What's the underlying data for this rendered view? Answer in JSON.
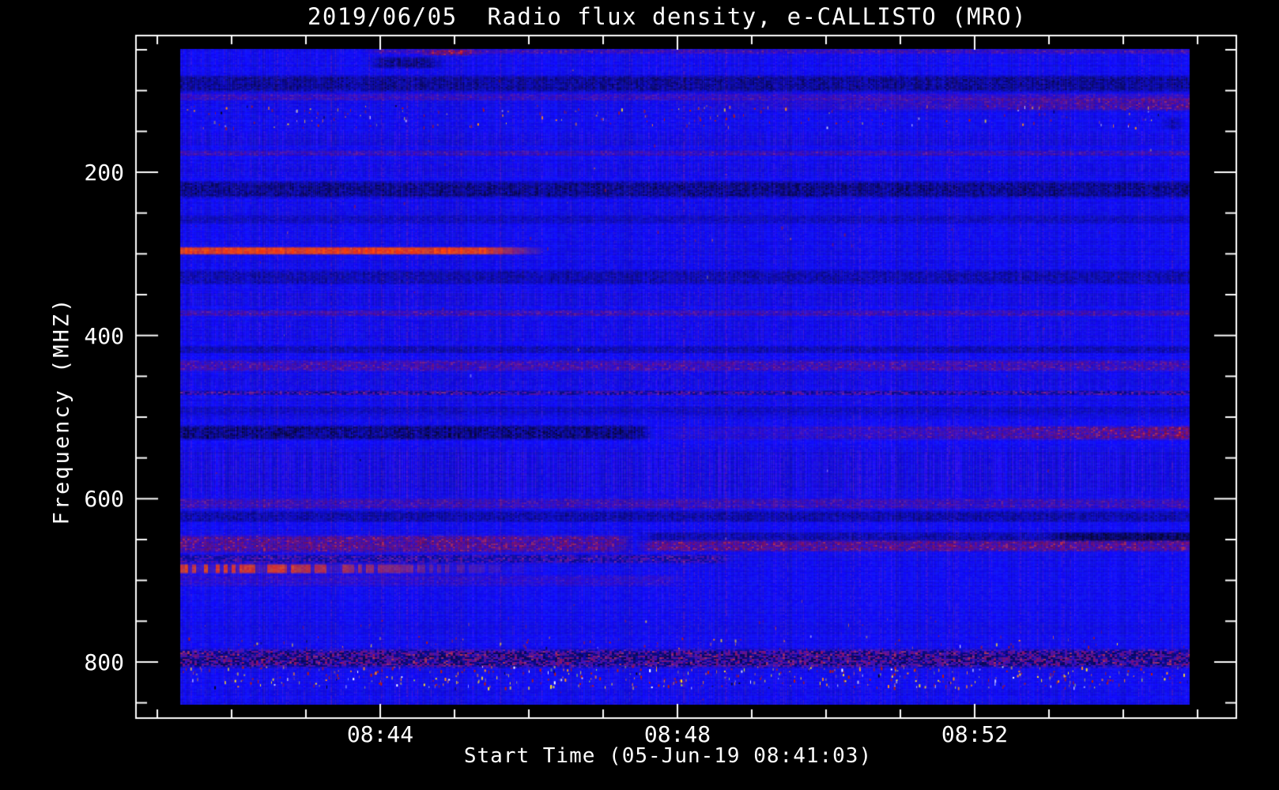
{
  "chart_data": {
    "type": "heatmap",
    "title": "2019/06/05  Radio flux density, e-CALLISTO (MRO)",
    "xlabel": "Start Time (05-Jun-19 08:41:03)",
    "ylabel": "Frequency (MHZ)",
    "instrument": "e-CALLISTO (MRO)",
    "date": "2019/06/05",
    "start_time": "08:41:03",
    "time_span": [
      "08:41:03",
      "08:55:00"
    ],
    "freq_span_mhz": [
      45,
      870
    ],
    "legend": "none",
    "grid": "off",
    "x_axis": {
      "major_ticks": [
        {
          "minute": 44,
          "label": "08:44"
        },
        {
          "minute": 48,
          "label": "08:48"
        },
        {
          "minute": 52,
          "label": "08:52"
        }
      ],
      "minor_tick_minutes": [
        41,
        42,
        43,
        45,
        46,
        47,
        49,
        50,
        51,
        53,
        54,
        55
      ]
    },
    "y_axis": {
      "major_ticks": [
        {
          "mhz": 200,
          "label": "200"
        },
        {
          "mhz": 400,
          "label": "400"
        },
        {
          "mhz": 600,
          "label": "600"
        },
        {
          "mhz": 800,
          "label": "800"
        }
      ],
      "minor_tick_mhz": [
        50,
        100,
        150,
        250,
        300,
        350,
        450,
        500,
        550,
        650,
        700,
        750,
        850
      ]
    },
    "colormap": "blue-red-yellow-white",
    "palette": {
      "background": "#000000",
      "frame": "#ffffff",
      "text": "#ffffff",
      "base_blue": "#1d14e6",
      "purple": "#6a28d8",
      "dark": "#04041a",
      "red": "#c01c08",
      "bright_red": "#f03008",
      "orange": "#ff8c1a",
      "yellow": "#ffe224",
      "white_hot": "#ffffff",
      "green": "#b8f030"
    },
    "features": [
      {
        "n": "top-edge-red-mottle",
        "k": "red",
        "x": [
          0.18,
          1
        ],
        "y": [
          0,
          0.008
        ],
        "i": 0.45
      },
      {
        "n": "top-red-streak",
        "k": "red",
        "x": [
          0.235,
          0.3
        ],
        "y": [
          0,
          0.011
        ],
        "i": 0.85
      },
      {
        "n": "dark-drift-patch",
        "k": "dark",
        "x": [
          0.183,
          0.263
        ],
        "y": [
          0.011,
          0.031
        ],
        "i": 0.8
      },
      {
        "n": "dark-band-95mhz",
        "k": "dark",
        "x": [
          0,
          1
        ],
        "y": [
          0.039,
          0.067
        ],
        "i": 0.75
      },
      {
        "n": "red-band-110mhz",
        "k": "red",
        "x": [
          0,
          1
        ],
        "y": [
          0.067,
          0.08
        ],
        "i": 0.35
      },
      {
        "n": "red-band-110mhz-right",
        "k": "red-ramp",
        "x": [
          0.5,
          1
        ],
        "y": [
          0.073,
          0.095
        ],
        "i": 0.7
      },
      {
        "n": "rfi-speckle-row-130mhz",
        "k": "speckle",
        "x": [
          0,
          1
        ],
        "y": [
          0.085,
          0.119
        ],
        "i": 0.5,
        "d": 0.02
      },
      {
        "n": "black-dashes-top-right",
        "k": "dark",
        "x": [
          0.97,
          0.995
        ],
        "y": [
          0.104,
          0.124
        ],
        "i": 0.9
      },
      {
        "n": "texture-strip-1",
        "k": "stripes",
        "x": [
          0,
          1
        ],
        "y": [
          0.124,
          0.15
        ],
        "i": 0.35
      },
      {
        "n": "thin-red-line-190",
        "k": "red",
        "x": [
          0,
          1
        ],
        "y": [
          0.154,
          0.164
        ],
        "i": 0.4
      },
      {
        "n": "texture-strip-2",
        "k": "stripes",
        "x": [
          0,
          1
        ],
        "y": [
          0.172,
          0.197
        ],
        "i": 0.3
      },
      {
        "n": "dark-band-230",
        "k": "dark",
        "x": [
          0,
          1
        ],
        "y": [
          0.2,
          0.229
        ],
        "i": 0.85
      },
      {
        "n": "dark-band-275",
        "k": "dark",
        "x": [
          0,
          1
        ],
        "y": [
          0.253,
          0.267
        ],
        "i": 0.4
      },
      {
        "n": "sparse-dots-290",
        "k": "speckle",
        "x": [
          0,
          1
        ],
        "y": [
          0.266,
          0.296
        ],
        "i": 0.2,
        "d": 0.0018
      },
      {
        "n": "bright-red-burst-streak",
        "k": "bright-red",
        "x": [
          0,
          0.375
        ],
        "y": [
          0.301,
          0.314
        ],
        "i": 1,
        "fade": 0.8
      },
      {
        "n": "dark-band-350",
        "k": "dark",
        "x": [
          0,
          1
        ],
        "y": [
          0.335,
          0.362
        ],
        "i": 0.55
      },
      {
        "n": "texture-strip-3",
        "k": "stripes",
        "x": [
          0,
          1
        ],
        "y": [
          0.366,
          0.394
        ],
        "i": 0.3
      },
      {
        "n": "red-line-395",
        "k": "red",
        "x": [
          0,
          1
        ],
        "y": [
          0.397,
          0.408
        ],
        "i": 0.45
      },
      {
        "n": "texture-strip-4",
        "k": "stripes",
        "x": [
          0,
          1
        ],
        "y": [
          0.413,
          0.448
        ],
        "i": 0.3
      },
      {
        "n": "dark-line-440",
        "k": "dark",
        "x": [
          0,
          1
        ],
        "y": [
          0.452,
          0.465
        ],
        "i": 0.5
      },
      {
        "n": "red-band-462",
        "k": "red",
        "x": [
          0,
          1
        ],
        "y": [
          0.473,
          0.493
        ],
        "i": 0.5
      },
      {
        "n": "texture-strip-5",
        "k": "stripes",
        "x": [
          0,
          1
        ],
        "y": [
          0.503,
          0.519
        ],
        "i": 0.3
      },
      {
        "n": "mixed-line-497",
        "k": "mixed",
        "x": [
          0,
          1
        ],
        "y": [
          0.52,
          0.529
        ],
        "i": 0.55
      },
      {
        "n": "faint-dark-520",
        "k": "dark",
        "x": [
          0,
          1
        ],
        "y": [
          0.543,
          0.56
        ],
        "i": 0.35
      },
      {
        "n": "black-band-left-545",
        "k": "dark",
        "x": [
          0,
          0.47
        ],
        "y": [
          0.572,
          0.597
        ],
        "i": 0.95
      },
      {
        "n": "red-band-right-545",
        "k": "red-ramp",
        "x": [
          0.47,
          1
        ],
        "y": [
          0.574,
          0.598
        ],
        "i": 0.92
      },
      {
        "n": "purple-stripe-zone",
        "k": "stripes",
        "x": [
          0,
          1
        ],
        "y": [
          0.604,
          0.689
        ],
        "i": 0.55
      },
      {
        "n": "red-band-640",
        "k": "red",
        "x": [
          0,
          1
        ],
        "y": [
          0.684,
          0.703
        ],
        "i": 0.42
      },
      {
        "n": "dark-band-655",
        "k": "dark",
        "x": [
          0,
          1
        ],
        "y": [
          0.704,
          0.723
        ],
        "i": 0.6
      },
      {
        "n": "dark-band-678-right",
        "k": "dark",
        "x": [
          0.45,
          1
        ],
        "y": [
          0.736,
          0.752
        ],
        "i": 0.55
      },
      {
        "n": "black-seg-678-far-right",
        "k": "dark",
        "x": [
          0.86,
          1
        ],
        "y": [
          0.736,
          0.752
        ],
        "i": 0.95
      },
      {
        "n": "red-band-685-left",
        "k": "red",
        "x": [
          0,
          0.45
        ],
        "y": [
          0.74,
          0.77
        ],
        "i": 0.72
      },
      {
        "n": "red-band-690-right",
        "k": "red",
        "x": [
          0.45,
          1
        ],
        "y": [
          0.748,
          0.767
        ],
        "i": 0.75
      },
      {
        "n": "mixed-row-705",
        "k": "mixed",
        "x": [
          0,
          0.55
        ],
        "y": [
          0.77,
          0.785
        ],
        "i": 0.45
      },
      {
        "n": "red-streak-718",
        "k": "bright-red",
        "x": [
          0,
          0.42
        ],
        "y": [
          0.784,
          0.801
        ],
        "i": 0.88,
        "fade": 0.22,
        "dashed": true
      },
      {
        "n": "red-tail-730",
        "k": "red",
        "x": [
          0,
          0.5
        ],
        "y": [
          0.801,
          0.82
        ],
        "i": 0.25
      },
      {
        "n": "faint-speck-row-785",
        "k": "speckle",
        "x": [
          0,
          1
        ],
        "y": [
          0.868,
          0.882
        ],
        "i": 0.3,
        "d": 0.004
      },
      {
        "n": "speck-band-810",
        "k": "speckle",
        "x": [
          0,
          1
        ],
        "y": [
          0.894,
          0.914
        ],
        "i": 0.5,
        "d": 0.014
      },
      {
        "n": "heavy-mottle-band-830",
        "k": "mixed",
        "x": [
          0,
          1
        ],
        "y": [
          0.913,
          0.946
        ],
        "i": 0.75
      },
      {
        "n": "bright-speckle-band-855",
        "k": "speckle-bright",
        "x": [
          0,
          1
        ],
        "y": [
          0.941,
          0.973
        ],
        "i": 0.8,
        "d": 0.05
      },
      {
        "n": "global-noise-specks",
        "k": "speckle",
        "x": [
          0,
          1
        ],
        "y": [
          0,
          1
        ],
        "i": 0.15,
        "d": 0.00025
      }
    ]
  }
}
